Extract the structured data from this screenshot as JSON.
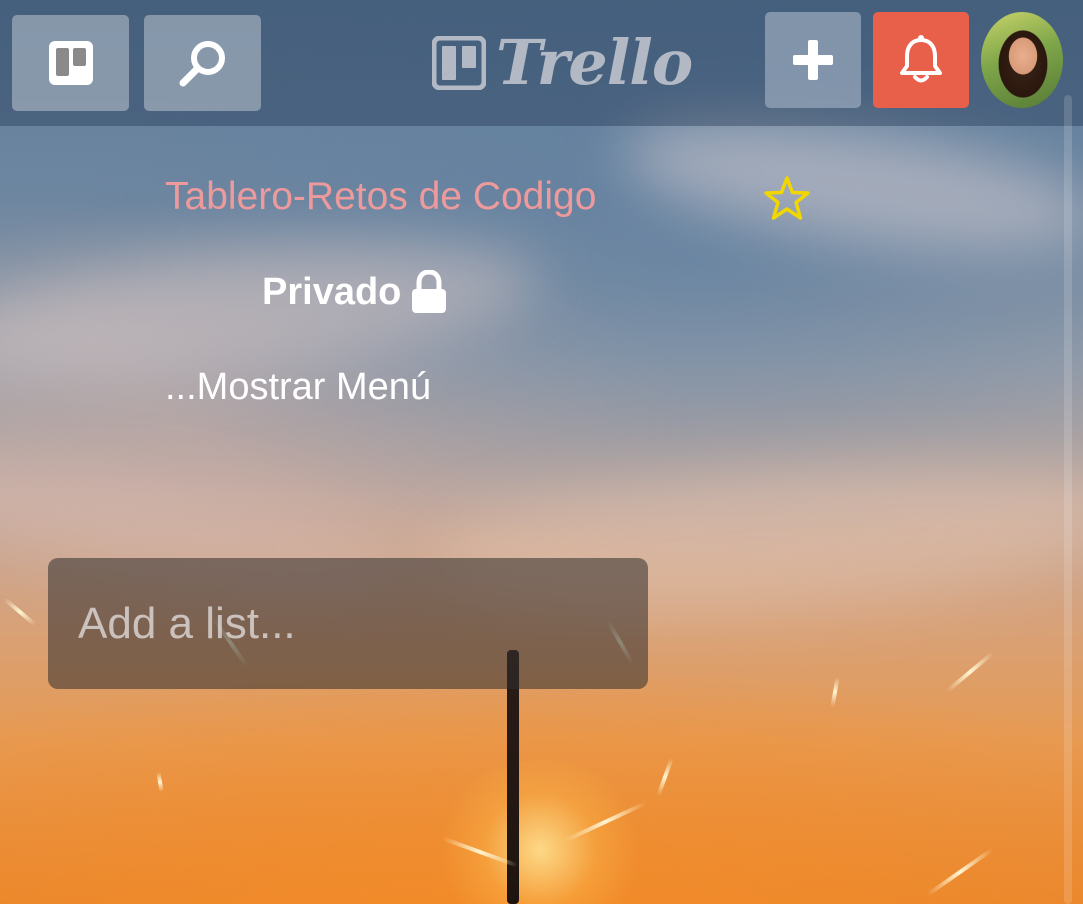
{
  "header": {
    "boards_button": {
      "icon": "boards-icon"
    },
    "search_button": {
      "icon": "search-icon"
    },
    "logo_text": "Trello",
    "add_button": {
      "icon": "plus-icon"
    },
    "notifications_button": {
      "icon": "bell-icon",
      "color": "#e9604a"
    },
    "avatar": {
      "icon": "user-avatar"
    }
  },
  "board": {
    "title": "Tablero-Retos de Codigo",
    "title_color": "#ee9a9c",
    "star_icon": "star-icon",
    "star_color": "#f2d600",
    "visibility_label": "Privado",
    "visibility_icon": "lock-icon",
    "show_menu_label": "...Mostrar Menú"
  },
  "lists": {
    "add_list_placeholder": "Add a list..."
  }
}
